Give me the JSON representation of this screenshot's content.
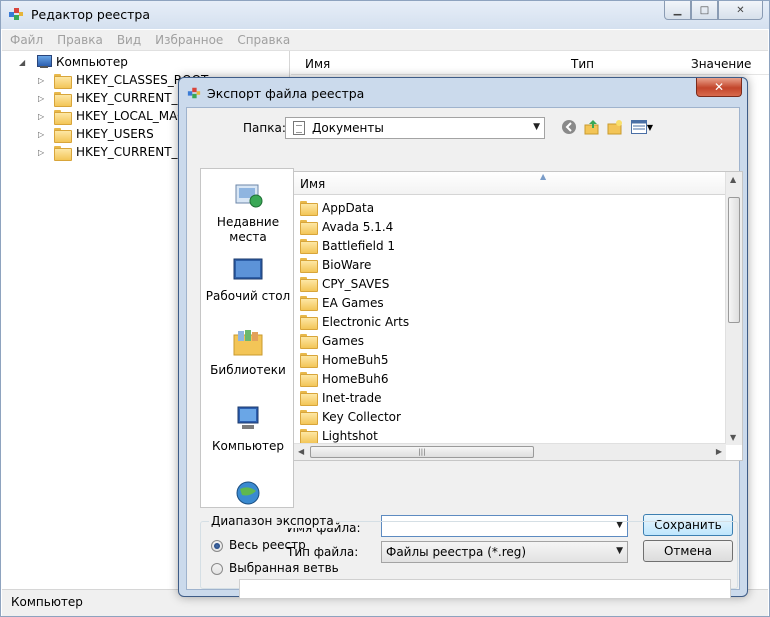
{
  "main": {
    "title": "Редактор реестра",
    "menu": [
      "Файл",
      "Правка",
      "Вид",
      "Избранное",
      "Справка"
    ],
    "tree": {
      "root": "Компьютер",
      "items": [
        "HKEY_CLASSES_ROOT",
        "HKEY_CURRENT_USER",
        "HKEY_LOCAL_MACHINE",
        "HKEY_USERS",
        "HKEY_CURRENT_CONFIG"
      ]
    },
    "list_columns": [
      "Имя",
      "Тип",
      "Значение"
    ],
    "status": "Компьютер"
  },
  "dialog": {
    "title": "Экспорт файла реестра",
    "close_label": "✕",
    "folder_label": "Папка:",
    "folder_value": "Документы",
    "places": [
      "Недавние места",
      "Рабочий стол",
      "Библиотеки",
      "Компьютер"
    ],
    "list_header": "Имя",
    "files": [
      "AppData",
      "Avada 5.1.4",
      "Battlefield 1",
      "BioWare",
      "CPY_SAVES",
      "EA Games",
      "Electronic Arts",
      "Games",
      "HomeBuh5",
      "HomeBuh6",
      "Inet-trade",
      "Key Collector",
      "Lightshot"
    ],
    "filename_label": "Имя файла:",
    "filename_value": "",
    "filetype_label": "Тип файла:",
    "filetype_value": "Файлы реестра (*.reg)",
    "save_label": "Сохранить",
    "cancel_label": "Отмена",
    "range": {
      "legend": "Диапазон экспорта",
      "all_label": "Весь реестр",
      "branch_label": "Выбранная ветвь",
      "selected": "all",
      "branch_value": ""
    }
  }
}
